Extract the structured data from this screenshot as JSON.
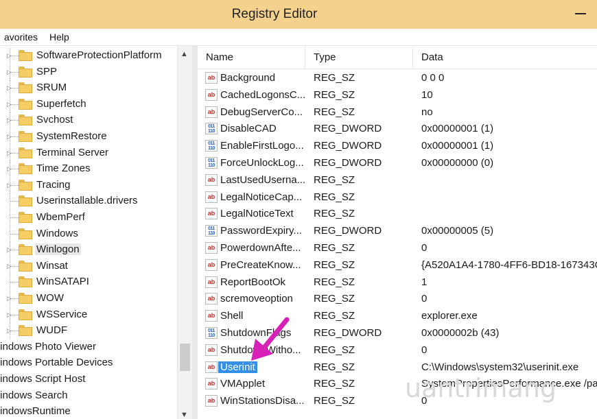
{
  "window": {
    "title": "Registry Editor"
  },
  "menu": {
    "items": [
      "avorites",
      "Help"
    ]
  },
  "tree": {
    "items": [
      {
        "label": "SoftwareProtectionPlatform",
        "expandable": true
      },
      {
        "label": "SPP",
        "expandable": true
      },
      {
        "label": "SRUM",
        "expandable": true
      },
      {
        "label": "Superfetch",
        "expandable": true
      },
      {
        "label": "Svchost",
        "expandable": true
      },
      {
        "label": "SystemRestore",
        "expandable": true
      },
      {
        "label": "Terminal Server",
        "expandable": true
      },
      {
        "label": "Time Zones",
        "expandable": true
      },
      {
        "label": "Tracing",
        "expandable": true
      },
      {
        "label": "Userinstallable.drivers",
        "expandable": false
      },
      {
        "label": "WbemPerf",
        "expandable": false
      },
      {
        "label": "Windows",
        "expandable": false
      },
      {
        "label": "Winlogon",
        "expandable": true,
        "selected": true
      },
      {
        "label": "Winsat",
        "expandable": true
      },
      {
        "label": "WinSATAPI",
        "expandable": false
      },
      {
        "label": "WOW",
        "expandable": true
      },
      {
        "label": "WSService",
        "expandable": true
      },
      {
        "label": "WUDF",
        "expandable": true
      }
    ],
    "root_items": [
      "/indows Photo Viewer",
      "/indows Portable Devices",
      "/indows Script Host",
      "/indows Search",
      "/indowsRuntime"
    ]
  },
  "list": {
    "columns": {
      "name": "Name",
      "type": "Type",
      "data": "Data"
    },
    "rows": [
      {
        "name": "Background",
        "type": "REG_SZ",
        "data": "0 0 0",
        "kind": "sz"
      },
      {
        "name": "CachedLogonsC...",
        "type": "REG_SZ",
        "data": "10",
        "kind": "sz"
      },
      {
        "name": "DebugServerCo...",
        "type": "REG_SZ",
        "data": "no",
        "kind": "sz"
      },
      {
        "name": "DisableCAD",
        "type": "REG_DWORD",
        "data": "0x00000001 (1)",
        "kind": "dword"
      },
      {
        "name": "EnableFirstLogo...",
        "type": "REG_DWORD",
        "data": "0x00000001 (1)",
        "kind": "dword"
      },
      {
        "name": "ForceUnlockLog...",
        "type": "REG_DWORD",
        "data": "0x00000000 (0)",
        "kind": "dword"
      },
      {
        "name": "LastUsedUserna...",
        "type": "REG_SZ",
        "data": "",
        "kind": "sz"
      },
      {
        "name": "LegalNoticeCap...",
        "type": "REG_SZ",
        "data": "",
        "kind": "sz"
      },
      {
        "name": "LegalNoticeText",
        "type": "REG_SZ",
        "data": "",
        "kind": "sz"
      },
      {
        "name": "PasswordExpiry...",
        "type": "REG_DWORD",
        "data": "0x00000005 (5)",
        "kind": "dword"
      },
      {
        "name": "PowerdownAfte...",
        "type": "REG_SZ",
        "data": "0",
        "kind": "sz"
      },
      {
        "name": "PreCreateKnow...",
        "type": "REG_SZ",
        "data": "{A520A1A4-1780-4FF6-BD18-167343C",
        "kind": "sz"
      },
      {
        "name": "ReportBootOk",
        "type": "REG_SZ",
        "data": "1",
        "kind": "sz"
      },
      {
        "name": "scremoveoption",
        "type": "REG_SZ",
        "data": "0",
        "kind": "sz"
      },
      {
        "name": "Shell",
        "type": "REG_SZ",
        "data": "explorer.exe",
        "kind": "sz"
      },
      {
        "name": "ShutdownFlags",
        "type": "REG_DWORD",
        "data": "0x0000002b (43)",
        "kind": "dword"
      },
      {
        "name": "ShutdownWitho...",
        "type": "REG_SZ",
        "data": "0",
        "kind": "sz"
      },
      {
        "name": "Userinit",
        "type": "REG_SZ",
        "data": "C:\\Windows\\system32\\userinit.exe",
        "kind": "sz",
        "selected": true
      },
      {
        "name": "VMApplet",
        "type": "REG_SZ",
        "data": "SystemPropertiesPerformance.exe /pa",
        "kind": "sz"
      },
      {
        "name": "WinStationsDisa...",
        "type": "REG_SZ",
        "data": "0",
        "kind": "sz"
      }
    ]
  },
  "icons": {
    "sz": "ab",
    "dword": "011 110"
  },
  "watermark": "uantrimang",
  "colors": {
    "titlebar": "#f4d28e",
    "selection": "#3390e6",
    "arrow": "#d81fb8"
  }
}
